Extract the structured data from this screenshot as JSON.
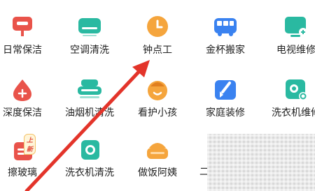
{
  "services": {
    "row1": [
      {
        "label": "日常保洁",
        "icon": "sign-board-icon"
      },
      {
        "label": "空调清洗",
        "icon": "air-conditioner-icon"
      },
      {
        "label": "钟点工",
        "icon": "clock-icon"
      },
      {
        "label": "金杯搬家",
        "icon": "van-icon"
      },
      {
        "label": "电视维修",
        "icon": "tv-repair-icon"
      }
    ],
    "row2": [
      {
        "label": "深度保洁",
        "icon": "drop-plus-icon"
      },
      {
        "label": "油烟机清洗",
        "icon": "range-hood-icon"
      },
      {
        "label": "看护小孩",
        "icon": "child-face-icon"
      },
      {
        "label": "家庭装修",
        "icon": "brush-icon"
      },
      {
        "label": "洗衣机维修",
        "icon": "washer-search-icon"
      }
    ],
    "row3": [
      {
        "label": "擦玻璃",
        "icon": "window-wipe-icon",
        "badge": "上新"
      },
      {
        "label": "洗衣机清洗",
        "icon": "washing-machine-icon"
      },
      {
        "label": "做饭阿姨",
        "icon": "cooking-pot-icon"
      },
      {
        "label": "二",
        "icon": ""
      }
    ]
  },
  "colors": {
    "red": "#e9534a",
    "teal": "#2ab9a1",
    "orange": "#f5a53d",
    "blue": "#3a82f0",
    "arrow": "#e3342a"
  }
}
